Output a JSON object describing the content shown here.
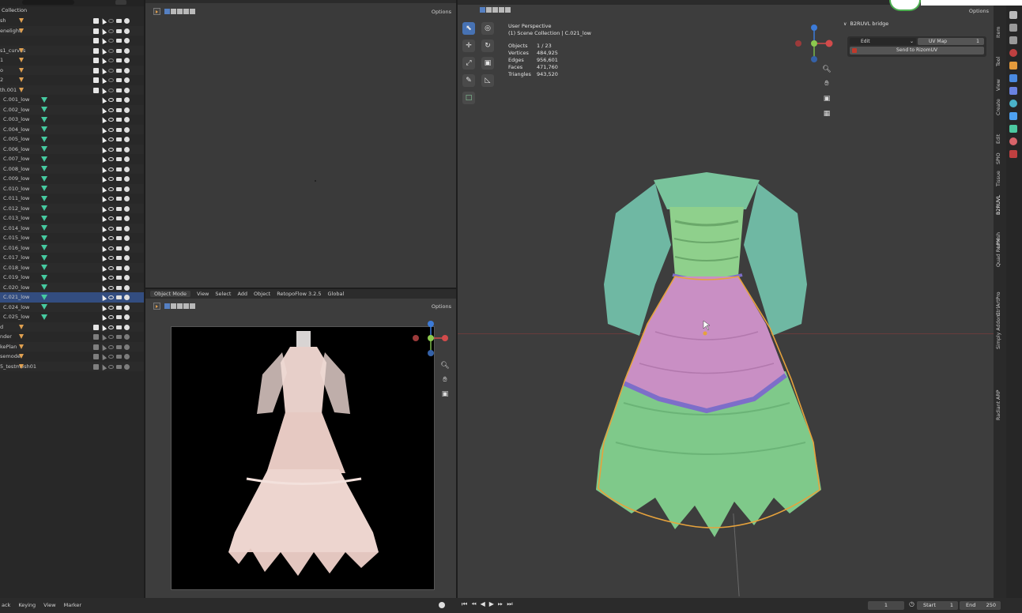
{
  "outliner": {
    "header": "Collection",
    "rows": [
      {
        "label": "sh",
        "indent": 0
      },
      {
        "label": "enelight",
        "indent": 0
      },
      {
        "label": "",
        "indent": 0
      },
      {
        "label": "s1_curves",
        "indent": 0
      },
      {
        "label": "1",
        "indent": 0
      },
      {
        "label": "o",
        "indent": 0
      },
      {
        "label": "2",
        "indent": 0
      },
      {
        "label": "th.001",
        "indent": 0
      },
      {
        "label": "C.001_low",
        "indent": 1
      },
      {
        "label": "C.002_low",
        "indent": 1
      },
      {
        "label": "C.003_low",
        "indent": 1
      },
      {
        "label": "C.004_low",
        "indent": 1
      },
      {
        "label": "C.005_low",
        "indent": 1
      },
      {
        "label": "C.006_low",
        "indent": 1
      },
      {
        "label": "C.007_low",
        "indent": 1
      },
      {
        "label": "C.008_low",
        "indent": 1
      },
      {
        "label": "C.009_low",
        "indent": 1
      },
      {
        "label": "C.010_low",
        "indent": 1
      },
      {
        "label": "C.011_low",
        "indent": 1
      },
      {
        "label": "C.012_low",
        "indent": 1
      },
      {
        "label": "C.013_low",
        "indent": 1
      },
      {
        "label": "C.014_low",
        "indent": 1
      },
      {
        "label": "C.015_low",
        "indent": 1
      },
      {
        "label": "C.016_low",
        "indent": 1
      },
      {
        "label": "C.017_low",
        "indent": 1
      },
      {
        "label": "C.018_low",
        "indent": 1
      },
      {
        "label": "C.019_low",
        "indent": 1
      },
      {
        "label": "C.020_low",
        "indent": 1
      },
      {
        "label": "C.021_low",
        "indent": 1,
        "selected": true
      },
      {
        "label": "C.024_low",
        "indent": 1
      },
      {
        "label": "C.025_low",
        "indent": 1
      },
      {
        "label": "d",
        "indent": 0
      },
      {
        "label": "nder",
        "indent": 0
      },
      {
        "label": "kePlan",
        "indent": 0
      },
      {
        "label": "semodel",
        "indent": 0
      },
      {
        "label": "5_testmesh01",
        "indent": 0
      }
    ]
  },
  "header_top_left": {
    "options": "Options"
  },
  "viewport_small": {
    "mode": "Object Mode",
    "menu": [
      "View",
      "Select",
      "Add",
      "Object"
    ],
    "addon": "RetopoFlow 3.2.5",
    "orientation": "Global",
    "options": "Options"
  },
  "viewport_main": {
    "title": "User Perspective",
    "subtitle": "(1) Scene Collection | C.021_low",
    "stats": [
      {
        "k": "Objects",
        "v": "1 / 23"
      },
      {
        "k": "Vertices",
        "v": "484,925"
      },
      {
        "k": "Edges",
        "v": "956,601"
      },
      {
        "k": "Faces",
        "v": "471,760"
      },
      {
        "k": "Triangles",
        "v": "943,520"
      }
    ],
    "options": "Options"
  },
  "npanel": {
    "title": "B2RUVL bridge",
    "mode": "Edit",
    "uvmap": "UV Map",
    "uvindex": "1",
    "send": "Send to RizomUV",
    "tabs": [
      "Item",
      "Tool",
      "View",
      "Create",
      "Edit",
      "SPIO",
      "Tissue",
      "B2RUVL",
      "LPM",
      "Quad Remesh",
      "CtrlArtPro",
      "Simply Addons",
      "ARP",
      "Radiant"
    ]
  },
  "timeline": {
    "left": [
      "ack",
      "Keying",
      "View",
      "Marker"
    ],
    "frame": "1",
    "start_label": "Start",
    "start": "1",
    "end_label": "End",
    "end": "250"
  },
  "colors": {
    "selection": "#334d80",
    "accent": "#4772b3",
    "mesh_green": "#7fc98a",
    "mesh_pink": "#c98fc4"
  }
}
